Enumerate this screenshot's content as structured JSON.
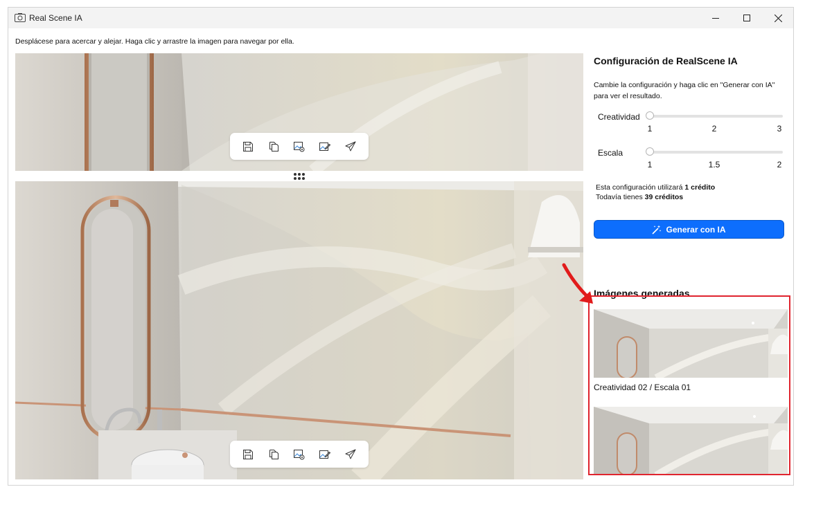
{
  "window": {
    "title": "Real Scene IA",
    "controls": [
      "minimize",
      "maximize",
      "close"
    ]
  },
  "hint": "Desplácese para acercar y alejar. Haga clic y arrastre la imagen para navegar por ella.",
  "toolbar": {
    "icons": [
      "save-icon",
      "copy-icon",
      "image-settings-icon",
      "edit-image-icon",
      "send-icon"
    ]
  },
  "panel": {
    "title": "Configuración de RealScene IA",
    "description": "Cambie la configuración y haga clic en \"Generar con IA\" para ver el resultado.",
    "creativity": {
      "label": "Creatividad",
      "ticks": [
        "1",
        "2",
        "3"
      ],
      "value": 1
    },
    "scale": {
      "label": "Escala",
      "ticks": [
        "1",
        "1.5",
        "2"
      ],
      "value": 1
    },
    "credits": {
      "line1_prefix": "Esta configuración utilizará",
      "line1_value": "1 crédito",
      "line2_prefix": "Todavía tienes",
      "line2_value": "39",
      "line2_suffix": "créditos"
    },
    "generate_button": "Generar con IA",
    "generated_title": "Imágenes generadas",
    "generated": [
      {
        "caption": "Creatividad 02 / Escala 01"
      },
      {
        "caption": ""
      }
    ]
  },
  "colors": {
    "accent": "#0d6efd",
    "highlight": "#e0242e",
    "titlebar": "#f3f3f3"
  }
}
